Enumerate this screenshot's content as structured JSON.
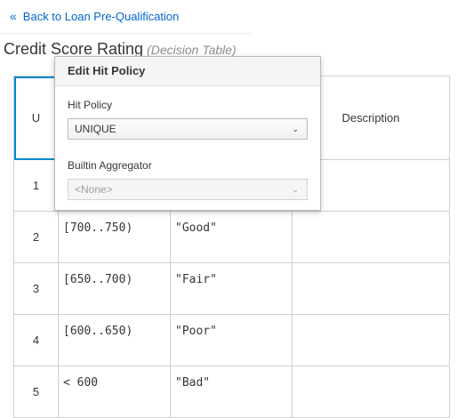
{
  "nav": {
    "back_icon": "«",
    "back_label": "Back to Loan Pre-Qualification"
  },
  "header": {
    "title": "Credit Score Rating",
    "subtitle": "(Decision Table)"
  },
  "table": {
    "hit_policy_label": "U",
    "description_header": "Description",
    "rows": [
      {
        "num": "1",
        "input": "",
        "output": ""
      },
      {
        "num": "2",
        "input": "[700..750)",
        "output": "\"Good\""
      },
      {
        "num": "3",
        "input": "[650..700)",
        "output": "\"Fair\""
      },
      {
        "num": "4",
        "input": "[600..650)",
        "output": "\"Poor\""
      },
      {
        "num": "5",
        "input": "< 600",
        "output": "\"Bad\""
      }
    ]
  },
  "popover": {
    "title": "Edit Hit Policy",
    "hit_policy_label": "Hit Policy",
    "hit_policy_value": "UNIQUE",
    "aggregator_label": "Builtin Aggregator",
    "aggregator_value": "<None>",
    "caret_icon": "⌄"
  }
}
